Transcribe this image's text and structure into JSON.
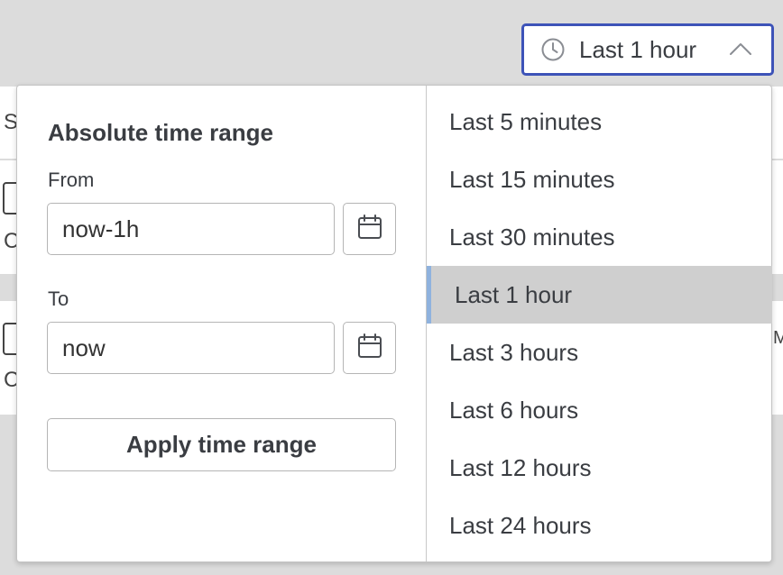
{
  "picker": {
    "label": "Last 1 hour",
    "icon": "clock-icon",
    "chevron": "chevron-up-icon",
    "focus_color": "#3d53b8"
  },
  "absolute": {
    "title": "Absolute time range",
    "from_label": "From",
    "from_value": "now-1h",
    "to_label": "To",
    "to_value": "now",
    "calendar_icon": "calendar-icon",
    "apply_label": "Apply time range"
  },
  "quick_ranges": {
    "items": [
      "Last 5 minutes",
      "Last 15 minutes",
      "Last 30 minutes",
      "Last 1 hour",
      "Last 3 hours",
      "Last 6 hours",
      "Last 12 hours",
      "Last 24 hours"
    ],
    "selected": "Last 1 hour",
    "selected_accent": "#8fb2de"
  }
}
